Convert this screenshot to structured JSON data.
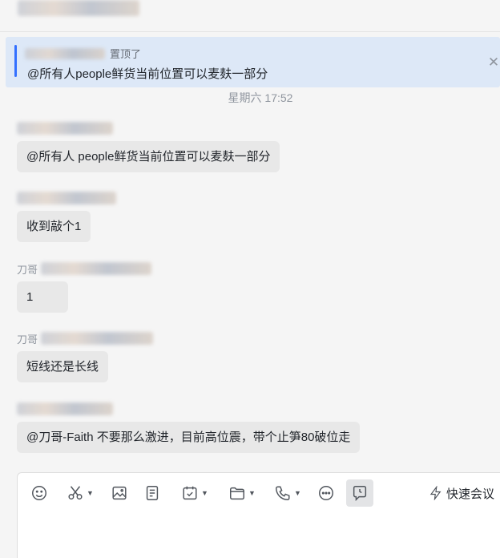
{
  "header": {
    "title": ""
  },
  "pinned": {
    "meta_suffix": "置顶了",
    "text": "@所有人people鲜货当前位置可以麦麸一部分",
    "close_icon": "close-icon"
  },
  "timestamp": "星期六 17:52",
  "messages": [
    {
      "sender": "",
      "text": "@所有人 people鲜货当前位置可以麦麸一部分"
    },
    {
      "sender": "",
      "text": "收到敲个1"
    },
    {
      "sender": "刀哥",
      "text": "1"
    },
    {
      "sender": "刀哥",
      "text": "短线还是长线"
    },
    {
      "sender": "",
      "text": "@刀哥-Faith 不要那么激进，目前高位震，带个止笋80破位走"
    }
  ],
  "toolbar": {
    "icons": [
      "emoji-icon",
      "scissors-icon",
      "image-icon",
      "document-icon",
      "calendar-check-icon",
      "folder-icon",
      "phone-icon",
      "more-icon",
      "message-time-icon"
    ],
    "quick_meeting_label": "快速会议"
  }
}
